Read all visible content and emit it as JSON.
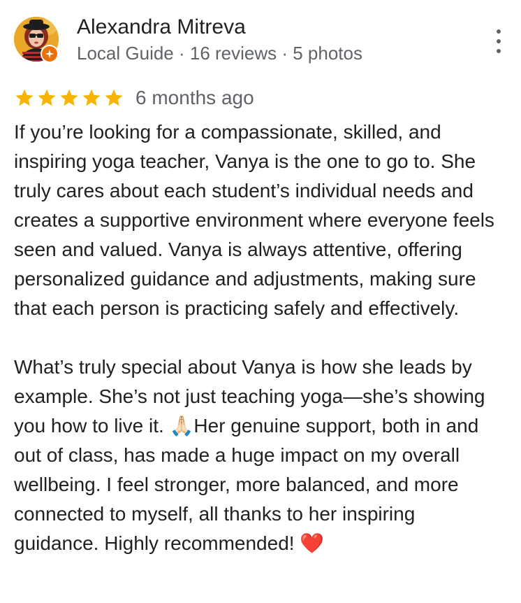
{
  "review": {
    "author_name": "Alexandra Mitreva",
    "author_meta": "Local Guide · 16 reviews · 5 photos",
    "rating": 5,
    "rating_max": 5,
    "date": "6 months ago",
    "paragraphs": [
      "If you’re looking for a compassionate, skilled, and inspiring yoga teacher, Vanya is the one to go to. She truly cares about each student’s individual needs and creates a supportive environment where everyone feels seen and valued. Vanya is always attentive, offering personalized guidance and adjustments, making sure that each person is practicing safely and effectively.",
      "What’s truly special about Vanya is how she leads by example. She’s not just teaching yoga—she’s showing you how to live it. 🙏🏻Her genuine support, both in and out of class, has made a huge impact on my overall wellbeing. I feel stronger, more balanced, and more connected to myself, all thanks to her inspiring guidance. Highly recommended! ❤️"
    ]
  },
  "icons": {
    "star": "star-icon",
    "menu": "more-vert-icon",
    "badge": "local-guide-badge-icon",
    "avatar": "profile-photo"
  },
  "colors": {
    "star": "#f5b400",
    "text": "#202124",
    "secondary_text": "#5f6368",
    "badge": "#e8710a"
  }
}
